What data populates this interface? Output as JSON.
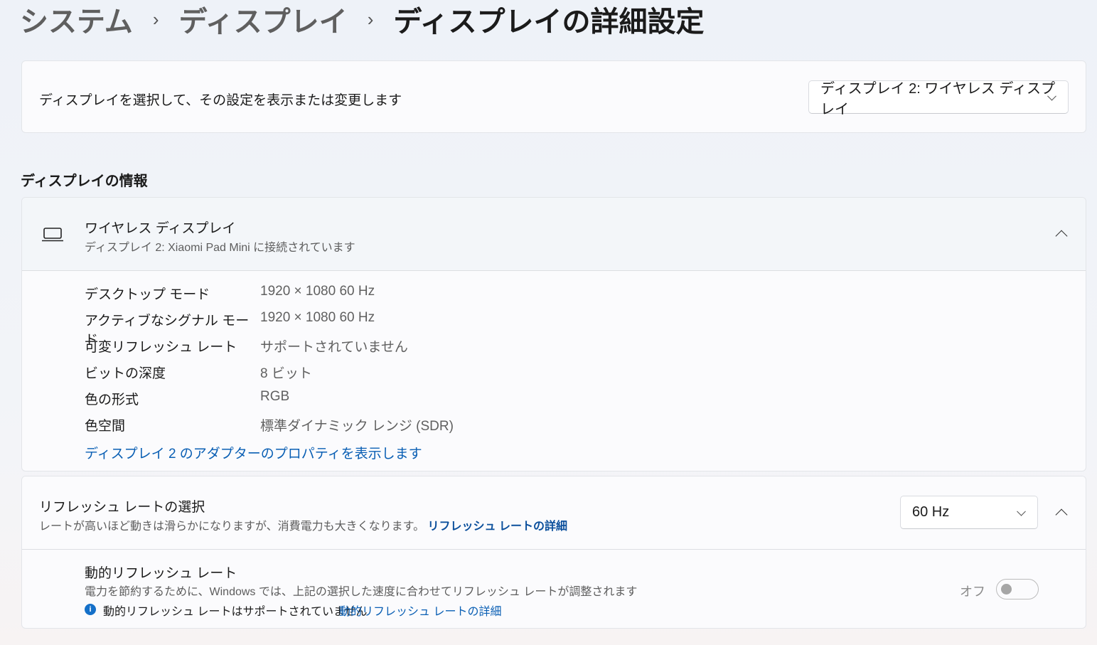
{
  "breadcrumb": {
    "items": [
      "システム",
      "ディスプレイ",
      "ディスプレイの詳細設定"
    ],
    "separator": "›"
  },
  "select_display": {
    "label": "ディスプレイを選択して、その設定を表示または変更します",
    "value": "ディスプレイ 2: ワイヤレス ディスプレイ"
  },
  "display_info": {
    "section_title": "ディスプレイの情報",
    "title": "ワイヤレス ディスプレイ",
    "subtitle": "ディスプレイ 2: Xiaomi Pad Mini に接続されています",
    "rows": [
      {
        "key": "デスクトップ モード",
        "value": "1920 × 1080 60 Hz"
      },
      {
        "key": "アクティブなシグナル モード",
        "value": "1920 × 1080 60 Hz"
      },
      {
        "key": "可変リフレッシュ レート",
        "value": "サポートされていません"
      },
      {
        "key": "ビットの深度",
        "value": "8 ビット"
      },
      {
        "key": "色の形式",
        "value": "RGB"
      },
      {
        "key": "色空間",
        "value": "標準ダイナミック レンジ (SDR)"
      }
    ],
    "adapter_link": "ディスプレイ 2 のアダプターのプロパティを表示します"
  },
  "refresh": {
    "title": "リフレッシュ レートの選択",
    "desc": "レートが高いほど動きは滑らかになりますが、消費電力も大きくなります。",
    "link": "リフレッシュ レートの詳細",
    "value": "60 Hz",
    "dynamic": {
      "title": "動的リフレッシュ レート",
      "desc": "電力を節約するために、Windows では、上記の選択した速度に合わせてリフレッシュ レートが調整されます",
      "info": "動的リフレッシュ レートはサポートされていません",
      "info_link": "動的リフレッシュ レートの詳細",
      "toggle_label": "オフ",
      "toggle_on": false
    }
  }
}
